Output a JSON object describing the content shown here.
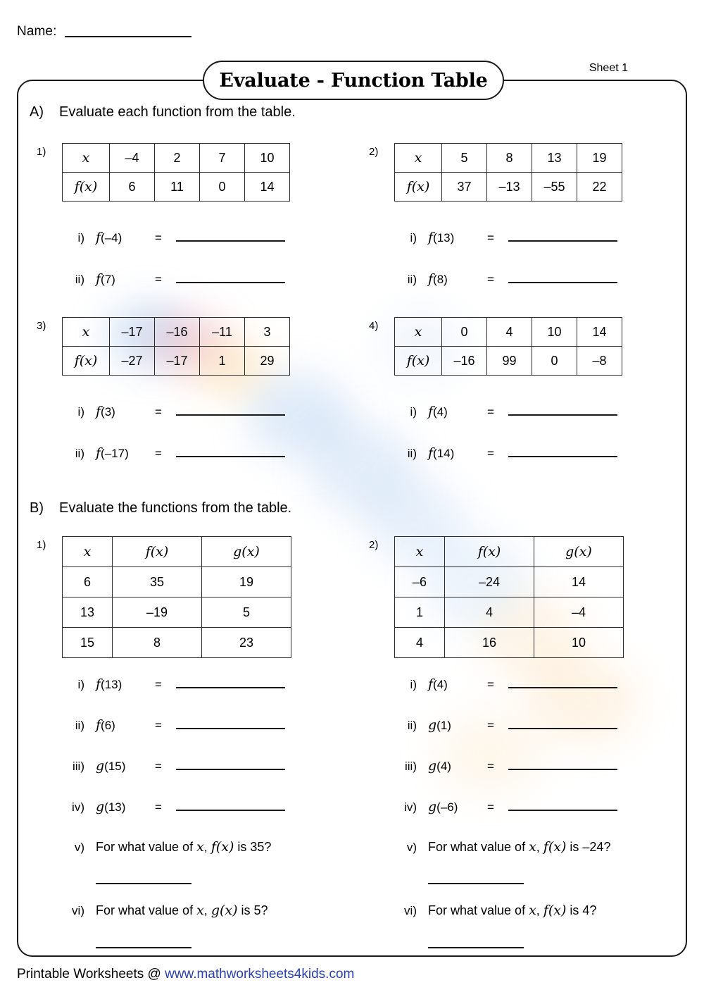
{
  "header": {
    "name_label": "Name:",
    "sheet_label": "Sheet 1",
    "title": "Evaluate - Function Table"
  },
  "sections": [
    {
      "letter": "A)",
      "instruction": "Evaluate each function from the table.",
      "problems": [
        {
          "num": "1)",
          "table": {
            "row_labels": [
              "x",
              "f(x)"
            ],
            "x": [
              "–4",
              "2",
              "7",
              "10"
            ],
            "fx": [
              "6",
              "11",
              "0",
              "14"
            ]
          },
          "questions": [
            {
              "roman": "i)",
              "expr_fn": "f",
              "expr_arg": "(–4)",
              "eq": "="
            },
            {
              "roman": "ii)",
              "expr_fn": "f",
              "expr_arg": "(7)",
              "eq": "="
            }
          ]
        },
        {
          "num": "2)",
          "table": {
            "row_labels": [
              "x",
              "f(x)"
            ],
            "x": [
              "5",
              "8",
              "13",
              "19"
            ],
            "fx": [
              "37",
              "–13",
              "–55",
              "22"
            ]
          },
          "questions": [
            {
              "roman": "i)",
              "expr_fn": "f",
              "expr_arg": "(13)",
              "eq": "="
            },
            {
              "roman": "ii)",
              "expr_fn": "f",
              "expr_arg": "(8)",
              "eq": "="
            }
          ]
        },
        {
          "num": "3)",
          "table": {
            "row_labels": [
              "x",
              "f(x)"
            ],
            "x": [
              "–17",
              "–16",
              "–11",
              "3"
            ],
            "fx": [
              "–27",
              "–17",
              "1",
              "29"
            ]
          },
          "questions": [
            {
              "roman": "i)",
              "expr_fn": "f",
              "expr_arg": "(3)",
              "eq": "="
            },
            {
              "roman": "ii)",
              "expr_fn": "f",
              "expr_arg": "(–17)",
              "eq": "="
            }
          ]
        },
        {
          "num": "4)",
          "table": {
            "row_labels": [
              "x",
              "f(x)"
            ],
            "x": [
              "0",
              "4",
              "10",
              "14"
            ],
            "fx": [
              "–16",
              "99",
              "0",
              "–8"
            ]
          },
          "questions": [
            {
              "roman": "i)",
              "expr_fn": "f",
              "expr_arg": "(4)",
              "eq": "="
            },
            {
              "roman": "ii)",
              "expr_fn": "f",
              "expr_arg": "(14)",
              "eq": "="
            }
          ]
        }
      ]
    },
    {
      "letter": "B)",
      "instruction": "Evaluate the functions from the table.",
      "problems": [
        {
          "num": "1)",
          "table": {
            "headers": [
              "x",
              "f(x)",
              "g(x)"
            ],
            "rows": [
              [
                "6",
                "35",
                "19"
              ],
              [
                "13",
                "–19",
                "5"
              ],
              [
                "15",
                "8",
                "23"
              ]
            ]
          },
          "questions": [
            {
              "roman": "i)",
              "expr_fn": "f",
              "expr_arg": "(13)",
              "eq": "="
            },
            {
              "roman": "ii)",
              "expr_fn": "f",
              "expr_arg": "(6)",
              "eq": "="
            },
            {
              "roman": "iii)",
              "expr_fn": "g",
              "expr_arg": "(15)",
              "eq": "="
            },
            {
              "roman": "iv)",
              "expr_fn": "g",
              "expr_arg": "(13)",
              "eq": "="
            }
          ],
          "word_questions": [
            {
              "roman": "v)",
              "prefix": "For what value of ",
              "var": "x",
              "comma": ", ",
              "fn": "f",
              "fn_arg": "(x)",
              "suffix": " is 35?"
            },
            {
              "roman": "vi)",
              "prefix": "For what value of ",
              "var": "x",
              "comma": ", ",
              "fn": "g",
              "fn_arg": "(x)",
              "suffix": " is 5?"
            }
          ]
        },
        {
          "num": "2)",
          "table": {
            "headers": [
              "x",
              "f(x)",
              "g(x)"
            ],
            "rows": [
              [
                "–6",
                "–24",
                "14"
              ],
              [
                "1",
                "4",
                "–4"
              ],
              [
                "4",
                "16",
                "10"
              ]
            ]
          },
          "questions": [
            {
              "roman": "i)",
              "expr_fn": "f",
              "expr_arg": "(4)",
              "eq": "="
            },
            {
              "roman": "ii)",
              "expr_fn": "g",
              "expr_arg": "(1)",
              "eq": "="
            },
            {
              "roman": "iii)",
              "expr_fn": "g",
              "expr_arg": "(4)",
              "eq": "="
            },
            {
              "roman": "iv)",
              "expr_fn": "g",
              "expr_arg": "(–6)",
              "eq": "="
            }
          ],
          "word_questions": [
            {
              "roman": "v)",
              "prefix": "For what value of ",
              "var": "x",
              "comma": ", ",
              "fn": "f",
              "fn_arg": "(x)",
              "suffix": " is –24?"
            },
            {
              "roman": "vi)",
              "prefix": "For what value of ",
              "var": "x",
              "comma": ", ",
              "fn": "f",
              "fn_arg": "(x)",
              "suffix": " is 4?"
            }
          ]
        }
      ]
    }
  ],
  "footer": {
    "prefix": "Printable Worksheets @ ",
    "url": "www.mathworksheets4kids.com",
    "url_color": "#2a41b4"
  }
}
